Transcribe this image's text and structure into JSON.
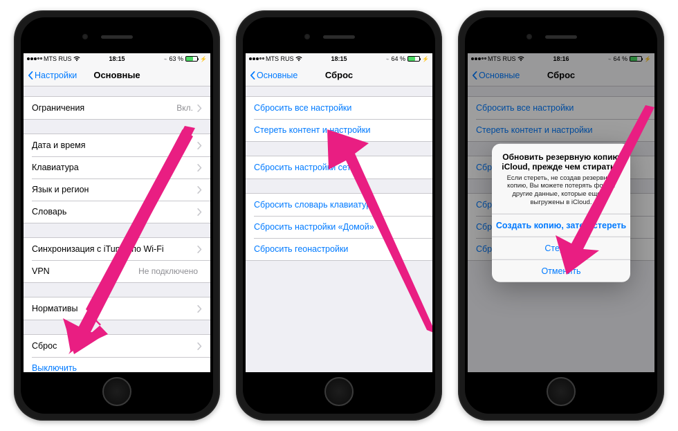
{
  "phone1": {
    "status": {
      "carrier": "MTS RUS",
      "signal_filled": 3,
      "wifi": true,
      "time": "18:15",
      "battery_pct": "63 %"
    },
    "nav": {
      "back": "Настройки",
      "title": "Основные"
    },
    "groups": [
      {
        "rows": [
          {
            "label": "Ограничения",
            "value": "Вкл.",
            "chevron": true,
            "interact": true
          }
        ]
      },
      {
        "rows": [
          {
            "label": "Дата и время",
            "chevron": true,
            "interact": true
          },
          {
            "label": "Клавиатура",
            "chevron": true,
            "interact": true
          },
          {
            "label": "Язык и регион",
            "chevron": true,
            "interact": true
          },
          {
            "label": "Словарь",
            "chevron": true,
            "interact": true
          }
        ]
      },
      {
        "rows": [
          {
            "label": "Синхронизация с iTunes по Wi-Fi",
            "chevron": true,
            "interact": true
          },
          {
            "label": "VPN",
            "value": "Не подключено",
            "chevron": false,
            "interact": true
          }
        ]
      },
      {
        "rows": [
          {
            "label": "Нормативы",
            "chevron": true,
            "interact": true
          }
        ]
      },
      {
        "rows": [
          {
            "label": "Сброс",
            "chevron": true,
            "interact": true
          },
          {
            "label": "Выключить",
            "link": true,
            "interact": true
          }
        ]
      }
    ]
  },
  "phone2": {
    "status": {
      "carrier": "MTS RUS",
      "signal_filled": 3,
      "wifi": true,
      "time": "18:15",
      "battery_pct": "64 %"
    },
    "nav": {
      "back": "Основные",
      "title": "Сброс"
    },
    "groups": [
      {
        "rows": [
          {
            "label": "Сбросить все настройки",
            "link": true,
            "interact": true
          },
          {
            "label": "Стереть контент и настройки",
            "link": true,
            "interact": true
          }
        ]
      },
      {
        "rows": [
          {
            "label": "Сбросить настройки сети",
            "link": true,
            "interact": true
          }
        ]
      },
      {
        "rows": [
          {
            "label": "Сбросить словарь клавиатуры",
            "link": true,
            "interact": true
          },
          {
            "label": "Сбросить настройки «Домой»",
            "link": true,
            "interact": true
          },
          {
            "label": "Сбросить геонастройки",
            "link": true,
            "interact": true
          }
        ]
      }
    ]
  },
  "phone3": {
    "status": {
      "carrier": "MTS RUS",
      "signal_filled": 3,
      "wifi": true,
      "time": "18:16",
      "battery_pct": "64 %"
    },
    "nav": {
      "back": "Основные",
      "title": "Сброс"
    },
    "groups": [
      {
        "rows": [
          {
            "label": "Сбросить все настройки",
            "link": true,
            "interact": true
          },
          {
            "label": "Стереть контент и настройки",
            "link": true,
            "interact": true
          }
        ]
      },
      {
        "rows": [
          {
            "label": "Сбросить настройки сети",
            "link": true,
            "interact": true
          }
        ]
      },
      {
        "rows": [
          {
            "label": "Сбросить словарь клавиатуры",
            "link": true,
            "interact": true
          },
          {
            "label": "Сбросить настройки «Домой»",
            "link": true,
            "interact": true
          },
          {
            "label": "Сбросить геонастройки",
            "link": true,
            "interact": true
          }
        ]
      }
    ],
    "alert": {
      "title": "Обновить резервную копию iCloud, прежде чем стирать?",
      "message": "Если стереть, не создав резервную копию, Вы можете потерять фото и другие данные, которые еще не выгружены в iCloud.",
      "buttons": [
        {
          "label": "Создать копию, затем стереть",
          "bold": true
        },
        {
          "label": "Стереть",
          "bold": false
        },
        {
          "label": "Отменить",
          "bold": false
        }
      ]
    }
  },
  "annotation_color": "#e91e82"
}
